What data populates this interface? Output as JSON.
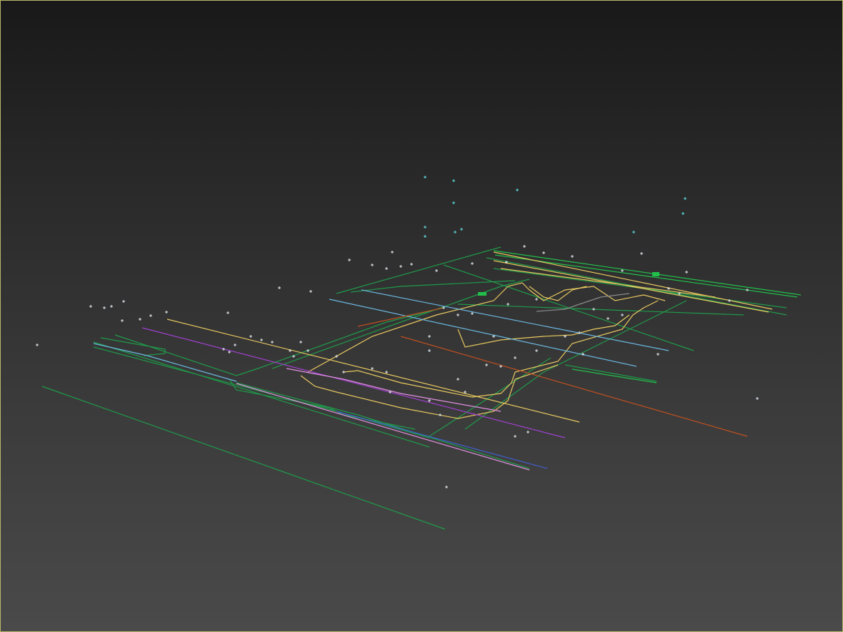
{
  "viewport": {
    "name": "perspective-viewport",
    "border_color": "#b8b86a",
    "gradient_top": "#191919",
    "gradient_bottom": "#4a4a4a"
  },
  "colors": {
    "green": "#1f9a4a",
    "bright_green": "#22c04a",
    "yellow": "#e8c860",
    "light_blue": "#6ab8e0",
    "purple": "#a040d0",
    "orange": "#c05020",
    "pink": "#e090e0",
    "blue": "#4060d0",
    "gray": "#8a8a8a",
    "point": "#e0e8f0",
    "cyan_point": "#60e0e0"
  }
}
